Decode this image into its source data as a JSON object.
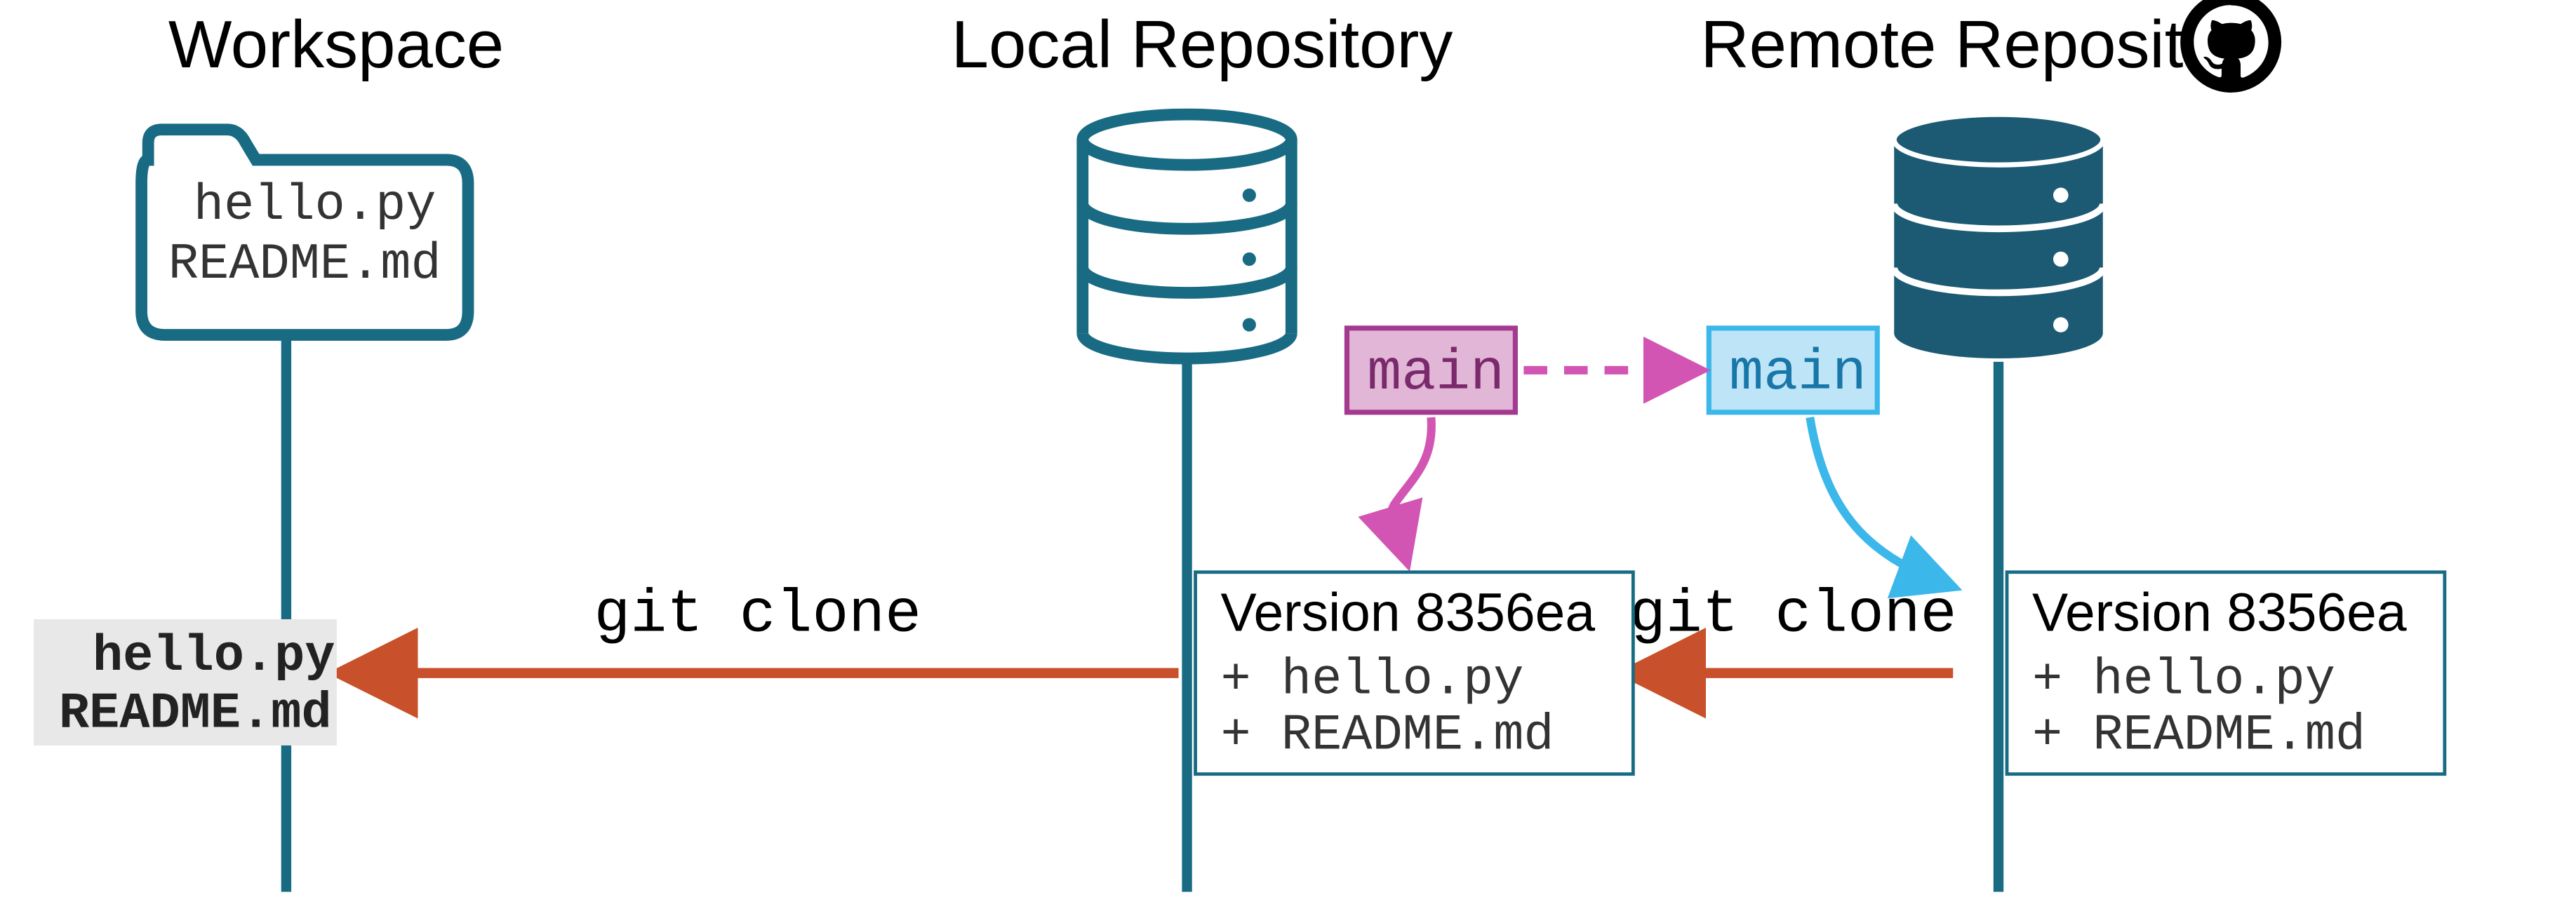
{
  "labels": {
    "workspace": "Workspace",
    "local": "Local Repository",
    "remote": "Remote Repository"
  },
  "workspace_folder": {
    "file1": "hello.py",
    "file2": "README.md"
  },
  "staged_box": {
    "file1": "hello.py",
    "file2": "README.md"
  },
  "commands": {
    "clone1": "git clone",
    "clone2": "git clone"
  },
  "branches": {
    "local": "main",
    "remote": "main"
  },
  "commit_local": {
    "title": "Version 8356ea",
    "line1": "+ hello.py",
    "line2": "+ README.md"
  },
  "commit_remote": {
    "title": "Version 8356ea",
    "line1": "+ hello.py",
    "line2": "+ README.md"
  },
  "colors": {
    "teal": "#196b84",
    "tealDark": "#1c5a74",
    "orange": "#c8502a",
    "magenta": "#b94da3",
    "magentaFill": "#e2b6d7",
    "cyan": "#3bb7ea",
    "cyanFill": "#bde4f7",
    "grey": "#e8e8e8"
  }
}
